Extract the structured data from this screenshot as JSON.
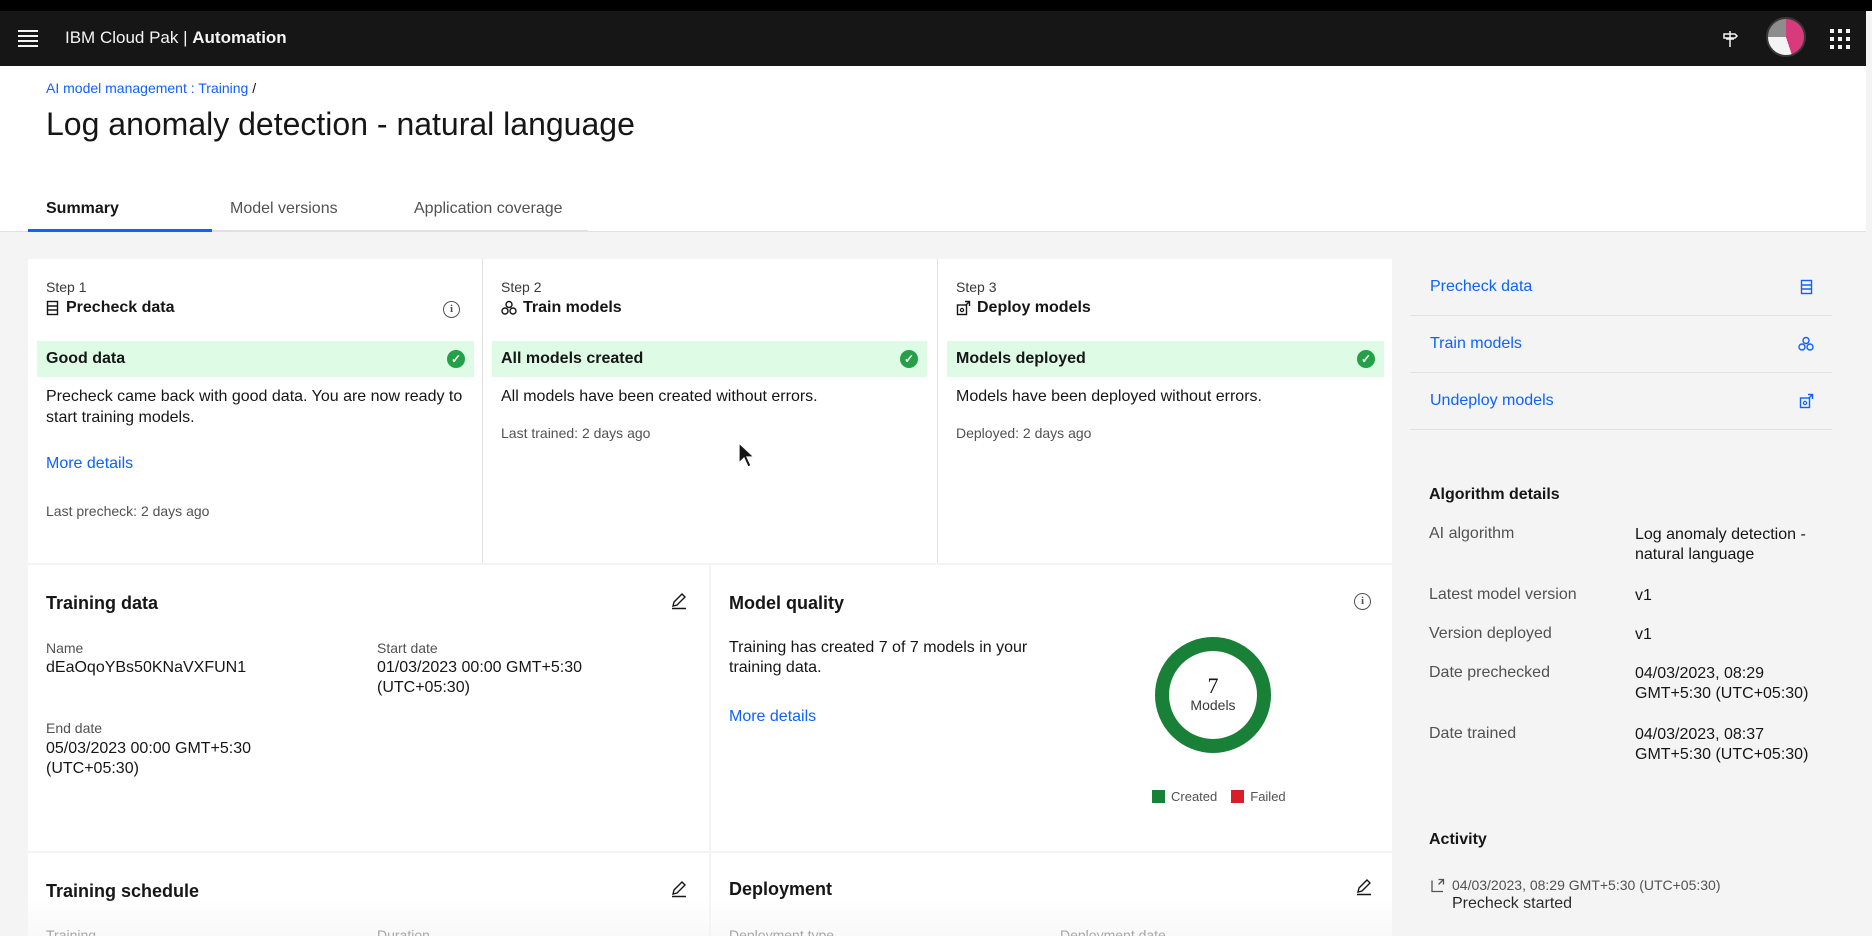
{
  "header": {
    "brand_prefix": "IBM Cloud Pak | ",
    "brand_name": "Automation"
  },
  "breadcrumb": {
    "link": "AI model management : Training",
    "separator": " /"
  },
  "page_title": "Log anomaly detection - natural language",
  "tabs": [
    {
      "label": "Summary",
      "active": true
    },
    {
      "label": "Model versions",
      "active": false
    },
    {
      "label": "Application coverage",
      "active": false
    }
  ],
  "steps": [
    {
      "num": "Step 1",
      "name": "Precheck data",
      "status": "Good data",
      "desc": "Precheck came back with good data. You are now ready to start training models.",
      "link": "More details",
      "meta": "Last precheck: 2 days ago"
    },
    {
      "num": "Step 2",
      "name": "Train models",
      "status": "All models created",
      "desc": "All models have been created without errors.",
      "meta": "Last trained: 2 days ago"
    },
    {
      "num": "Step 3",
      "name": "Deploy models",
      "status": "Models deployed",
      "desc": "Models have been deployed without errors.",
      "meta": "Deployed: 2 days ago"
    }
  ],
  "training_data": {
    "title": "Training data",
    "name_label": "Name",
    "name_value": "dEaOqoYBs50KNaVXFUN1",
    "start_label": "Start date",
    "start_value": "01/03/2023 00:00 GMT+5:30 (UTC+05:30)",
    "end_label": "End date",
    "end_value": "05/03/2023 00:00 GMT+5:30 (UTC+05:30)"
  },
  "model_quality": {
    "title": "Model quality",
    "desc": "Training has created 7 of 7 models in your training data.",
    "link": "More details",
    "count": "7",
    "count_label": "Models",
    "legend_created": "Created",
    "legend_failed": "Failed",
    "created_color": "#198038",
    "failed_color": "#da1e28",
    "created": 7,
    "failed": 0
  },
  "training_schedule": {
    "title": "Training schedule",
    "col1": "Training",
    "col2": "Duration"
  },
  "deployment": {
    "title": "Deployment",
    "col1": "Deployment type",
    "col2": "Deployment date"
  },
  "side_actions": [
    {
      "label": "Precheck data",
      "icon": "precheck-icon"
    },
    {
      "label": "Train models",
      "icon": "train-icon"
    },
    {
      "label": "Undeploy models",
      "icon": "undeploy-icon"
    }
  ],
  "algorithm": {
    "title": "Algorithm details",
    "rows": [
      {
        "label": "AI algorithm",
        "value": "Log anomaly detection - natural language"
      },
      {
        "label": "Latest model version",
        "value": "v1"
      },
      {
        "label": "Version deployed",
        "value": "v1"
      },
      {
        "label": "Date prechecked",
        "value": "04/03/2023, 08:29 GMT+5:30 (UTC+05:30)"
      },
      {
        "label": "Date trained",
        "value": "04/03/2023, 08:37 GMT+5:30 (UTC+05:30)"
      }
    ]
  },
  "activity": {
    "title": "Activity",
    "time": "04/03/2023, 08:29 GMT+5:30 (UTC+05:30)",
    "text": "Precheck started"
  },
  "colors": {
    "header_bg": "#161616",
    "link": "#0f62fe",
    "success_bg": "#defbe6",
    "success": "#24a148"
  }
}
